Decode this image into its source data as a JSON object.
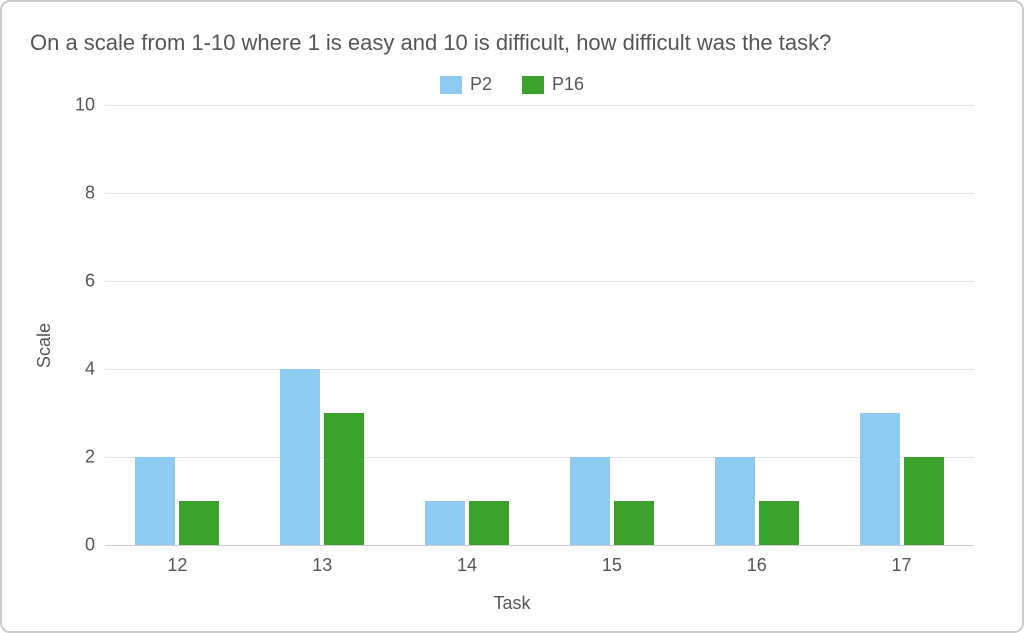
{
  "chart_data": {
    "type": "bar",
    "title": "On a scale from 1-10 where 1 is easy and 10 is difficult, how difficult was the task?",
    "xlabel": "Task",
    "ylabel": "Scale",
    "ylim": [
      0,
      10
    ],
    "yticks": [
      0,
      2,
      4,
      6,
      8,
      10
    ],
    "categories": [
      "12",
      "13",
      "14",
      "15",
      "16",
      "17"
    ],
    "series": [
      {
        "name": "P2",
        "color": "#8fcaf2",
        "values": [
          2,
          4,
          1,
          2,
          2,
          3
        ]
      },
      {
        "name": "P16",
        "color": "#3ba22b",
        "values": [
          1,
          3,
          1,
          1,
          1,
          2
        ]
      }
    ],
    "legend_position": "top"
  }
}
